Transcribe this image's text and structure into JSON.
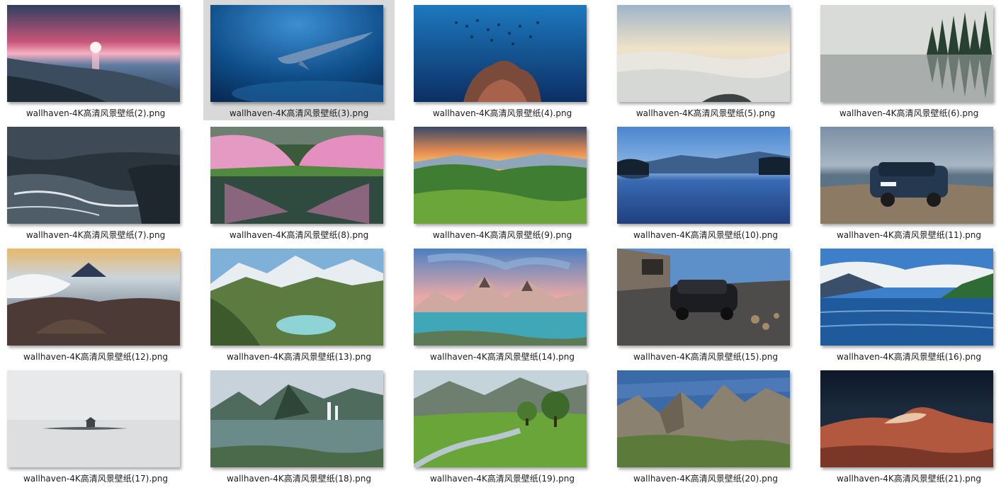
{
  "files": [
    {
      "name": "wallhaven-4K高清风景壁纸(2).png",
      "scene": "pink-sunset-beach",
      "selected": false
    },
    {
      "name": "wallhaven-4K高清风景壁纸(3).png",
      "scene": "underwater-shark",
      "selected": true
    },
    {
      "name": "wallhaven-4K高清风景壁纸(4).png",
      "scene": "coral-fish-school",
      "selected": false
    },
    {
      "name": "wallhaven-4K高清风景壁纸(5).png",
      "scene": "sea-of-clouds",
      "selected": false
    },
    {
      "name": "wallhaven-4K高清风景壁纸(6).png",
      "scene": "misty-forest-lake",
      "selected": false
    },
    {
      "name": "wallhaven-4K高清风景壁纸(7).png",
      "scene": "stormy-coast-cliffs",
      "selected": false
    },
    {
      "name": "wallhaven-4K高清风景壁纸(8).png",
      "scene": "cherry-blossom-river",
      "selected": false
    },
    {
      "name": "wallhaven-4K高清风景壁纸(9).png",
      "scene": "green-valley-sunset",
      "selected": false
    },
    {
      "name": "wallhaven-4K高清风景壁纸(10).png",
      "scene": "blue-lake-reflection",
      "selected": false
    },
    {
      "name": "wallhaven-4K高清风景壁纸(11).png",
      "scene": "car-on-rocky-shore",
      "selected": false
    },
    {
      "name": "wallhaven-4K高清风景壁纸(12).png",
      "scene": "volcano-smoke",
      "selected": false
    },
    {
      "name": "wallhaven-4K高清风景壁纸(13).png",
      "scene": "alpine-lake-mountains",
      "selected": false
    },
    {
      "name": "wallhaven-4K高清风景壁纸(14).png",
      "scene": "pink-peaks-lake",
      "selected": false
    },
    {
      "name": "wallhaven-4K高清风景壁纸(15).png",
      "scene": "car-by-stone-house",
      "selected": false
    },
    {
      "name": "wallhaven-4K高清风景壁纸(16).png",
      "scene": "cloudy-lake-mountains",
      "selected": false
    },
    {
      "name": "wallhaven-4K高清风景壁纸(17).png",
      "scene": "foggy-islet",
      "selected": false
    },
    {
      "name": "wallhaven-4K高清风景壁纸(18).png",
      "scene": "fjord-waterfall",
      "selected": false
    },
    {
      "name": "wallhaven-4K高清风景壁纸(19).png",
      "scene": "meadow-stream-trees",
      "selected": false
    },
    {
      "name": "wallhaven-4K高清风景壁纸(20).png",
      "scene": "rocky-cliffs-sky",
      "selected": false
    },
    {
      "name": "wallhaven-4K高清风景壁纸(21).png",
      "scene": "red-sandstone-night",
      "selected": false
    }
  ]
}
